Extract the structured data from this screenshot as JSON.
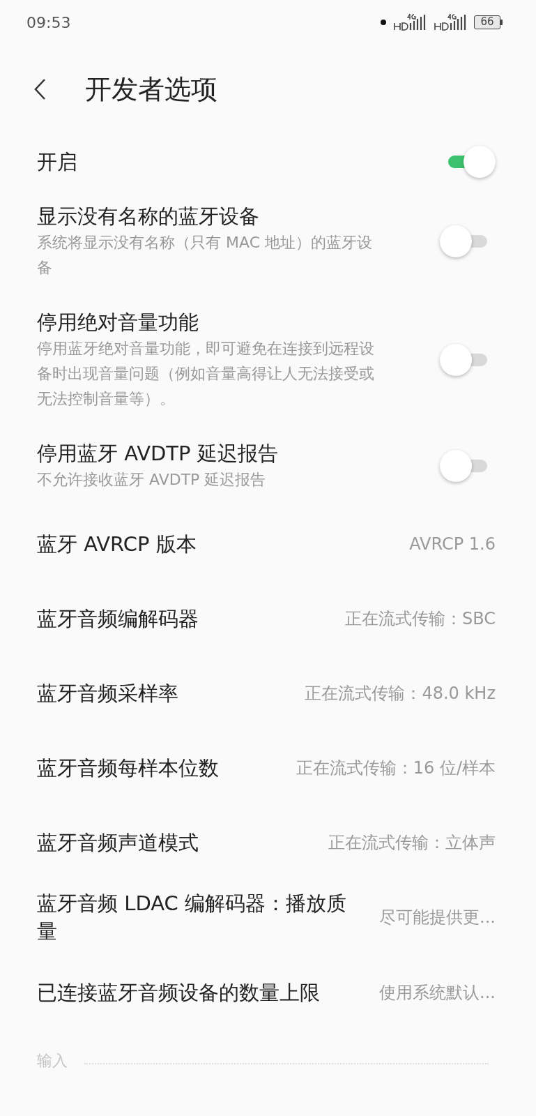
{
  "status_bar": {
    "time": "09:53",
    "battery": "66"
  },
  "header": {
    "title": "开发者选项"
  },
  "items": [
    {
      "kind": "toggle",
      "title": "开启",
      "on": true
    },
    {
      "kind": "toggle",
      "title": "显示没有名称的蓝牙设备",
      "subtitle": "系统将显示没有名称（只有 MAC 地址）的蓝牙设备",
      "on": false
    },
    {
      "kind": "toggle",
      "title": "停用绝对音量功能",
      "subtitle": "停用蓝牙绝对音量功能，即可避免在连接到远程设备时出现音量问题（例如音量高得让人无法接受或无法控制音量等）。",
      "on": false
    },
    {
      "kind": "toggle",
      "title": "停用蓝牙 AVDTP 延迟报告",
      "subtitle": "不允许接收蓝牙 AVDTP 延迟报告",
      "on": false
    },
    {
      "kind": "value",
      "title": "蓝牙 AVRCP 版本",
      "value": "AVRCP 1.6"
    },
    {
      "kind": "value",
      "title": "蓝牙音频编解码器",
      "value": "正在流式传输：SBC"
    },
    {
      "kind": "value",
      "title": "蓝牙音频采样率",
      "value": "正在流式传输：48.0 kHz"
    },
    {
      "kind": "value",
      "title": "蓝牙音频每样本位数",
      "value": "正在流式传输：16 位/样本"
    },
    {
      "kind": "value",
      "title": "蓝牙音频声道模式",
      "value": "正在流式传输：立体声"
    },
    {
      "kind": "value",
      "title": "蓝牙音频 LDAC 编解码器：播放质量",
      "value": "尽可能提供更..."
    },
    {
      "kind": "value",
      "title": "已连接蓝牙音频设备的数量上限",
      "value": "使用系统默认..."
    }
  ],
  "section": {
    "title": "输入"
  }
}
